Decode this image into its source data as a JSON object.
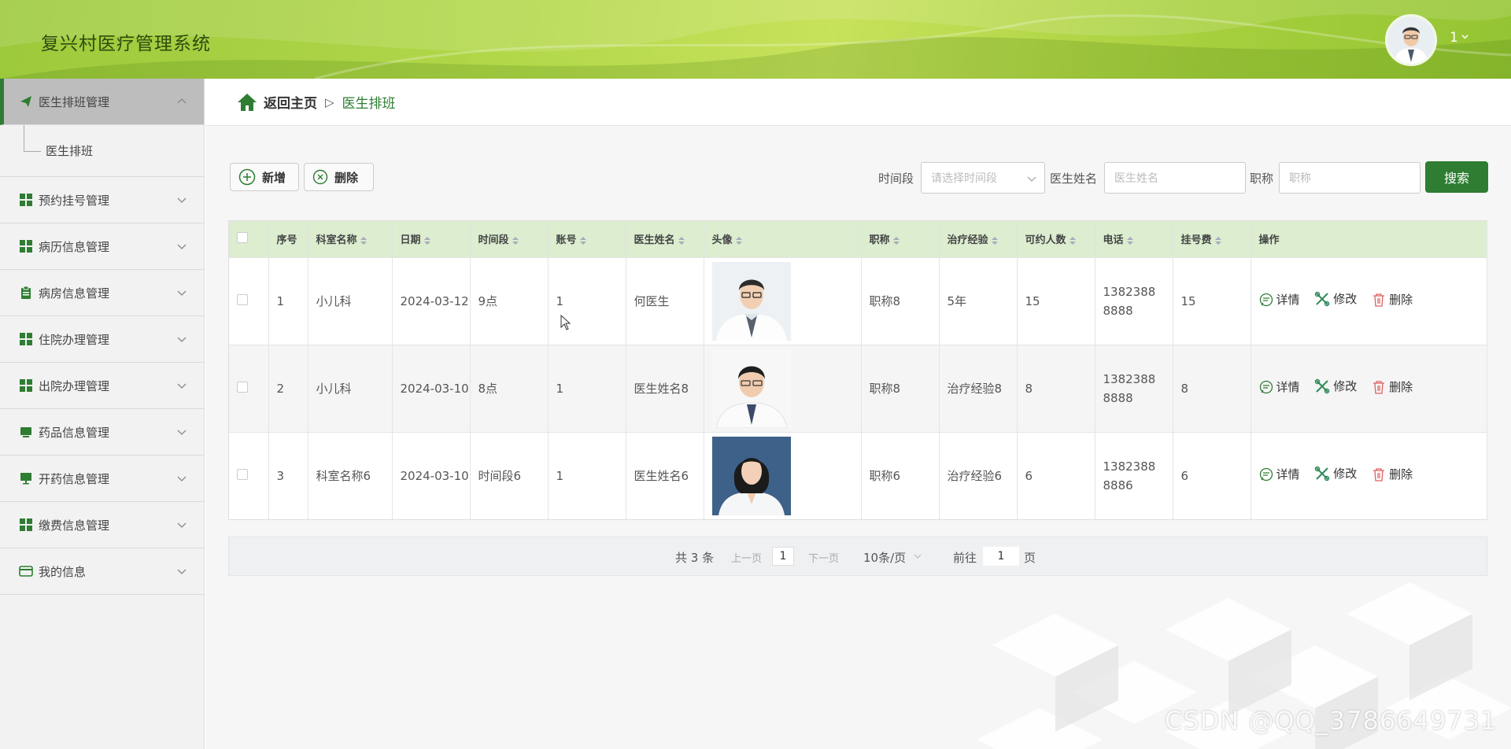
{
  "header": {
    "app_title": "复兴村医疗管理系统",
    "user_name": "1"
  },
  "sidebar": {
    "items": [
      {
        "label": "医生排班管理",
        "icon": "paper-plane-icon",
        "active": true,
        "sub": [
          "医生排班"
        ]
      },
      {
        "label": "预约挂号管理",
        "icon": "grid-icon"
      },
      {
        "label": "病历信息管理",
        "icon": "grid-icon"
      },
      {
        "label": "病房信息管理",
        "icon": "clipboard-icon"
      },
      {
        "label": "住院办理管理",
        "icon": "grid-icon"
      },
      {
        "label": "出院办理管理",
        "icon": "grid-icon"
      },
      {
        "label": "药品信息管理",
        "icon": "monitor-icon"
      },
      {
        "label": "开药信息管理",
        "icon": "desktop-icon"
      },
      {
        "label": "缴费信息管理",
        "icon": "grid-icon"
      },
      {
        "label": "我的信息",
        "icon": "card-icon"
      }
    ]
  },
  "breadcrumb": {
    "home": "返回主页",
    "current": "医生排班"
  },
  "toolbar": {
    "add_label": "新增",
    "delete_label": "删除"
  },
  "search": {
    "time_label": "时间段",
    "time_placeholder": "请选择时间段",
    "name_label": "医生姓名",
    "name_placeholder": "医生姓名",
    "title_label": "职称",
    "title_placeholder": "职称",
    "search_label": "搜索"
  },
  "table": {
    "columns": [
      "序号",
      "科室名称",
      "日期",
      "时间段",
      "账号",
      "医生姓名",
      "头像",
      "职称",
      "治疗经验",
      "可约人数",
      "电话",
      "挂号费",
      "操作"
    ],
    "rows": [
      {
        "no": "1",
        "dept": "小儿科",
        "date": "2024-03-12",
        "period": "9点",
        "account": "1",
        "name": "何医生",
        "title": "职称8",
        "exp": "5年",
        "quota": "15",
        "phone": "13823888888",
        "fee": "15"
      },
      {
        "no": "2",
        "dept": "小儿科",
        "date": "2024-03-10",
        "period": "8点",
        "account": "1",
        "name": "医生姓名8",
        "title": "职称8",
        "exp": "治疗经验8",
        "quota": "8",
        "phone": "13823888888",
        "fee": "8"
      },
      {
        "no": "3",
        "dept": "科室名称6",
        "date": "2024-03-10",
        "period": "时间段6",
        "account": "1",
        "name": "医生姓名6",
        "title": "职称6",
        "exp": "治疗经验6",
        "quota": "6",
        "phone": "13823888886",
        "fee": "6"
      }
    ],
    "actions": {
      "detail": "详情",
      "edit": "修改",
      "delete": "删除"
    }
  },
  "pagination": {
    "total_text": "共 3 条",
    "prev": "上一页",
    "page": "1",
    "next": "下一页",
    "page_size": "10条/页",
    "goto_label": "前往",
    "goto_value": "1",
    "goto_suffix": "页"
  },
  "watermark": "CSDN @QQ_3786649731",
  "colors": {
    "primary": "#2e7d32",
    "header_green": "#a6cf3d",
    "table_header": "#dcedd0"
  }
}
